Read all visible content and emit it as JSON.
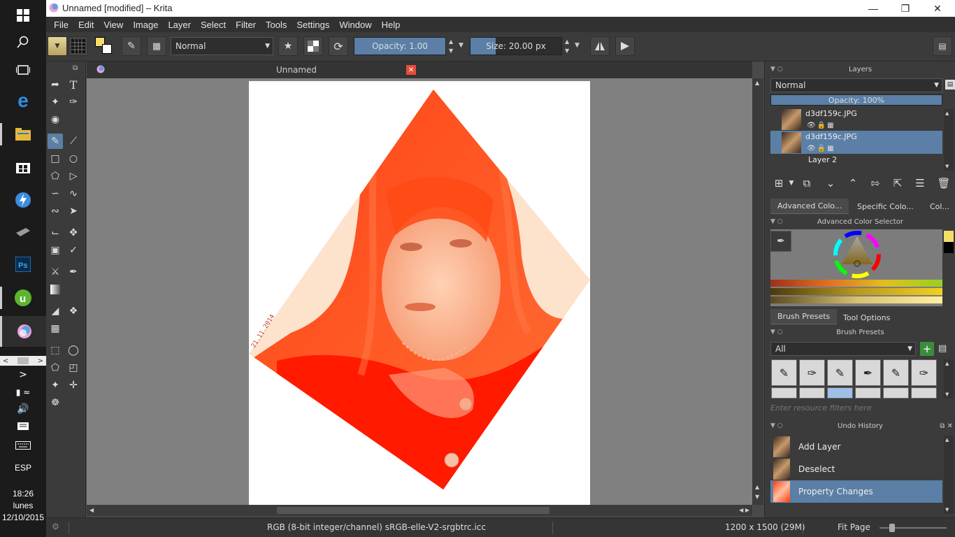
{
  "window": {
    "title": "Unnamed [modified] – Krita",
    "minimize": "—",
    "maximize": "❐",
    "close": "✕"
  },
  "menu": [
    "File",
    "Edit",
    "View",
    "Image",
    "Layer",
    "Select",
    "Filter",
    "Tools",
    "Settings",
    "Window",
    "Help"
  ],
  "toolbar": {
    "blend_mode": "Normal",
    "opacity_label": "Opacity:  1.00",
    "opacity_value": 1.0,
    "size_label": "Size:  20.00 px",
    "size_value": 20.0
  },
  "document_tab": {
    "label": "Unnamed",
    "close_icon": "close-icon"
  },
  "canvas": {
    "image_stamp": "21.11.2014"
  },
  "status": {
    "color_profile": "RGB (8-bit integer/channel)  sRGB-elle-V2-srgbtrc.icc",
    "dimensions": "1200 x 1500 (29M)",
    "zoom": "Fit Page"
  },
  "layers_docker": {
    "title": "Layers",
    "blend_mode": "Normal",
    "opacity": "Opacity:  100%",
    "opacity_value": 100,
    "layers": [
      {
        "name": "d3df159c.JPG",
        "selected": false
      },
      {
        "name": "d3df159c.JPG",
        "selected": true
      },
      {
        "name": "Layer 2",
        "selected": false
      }
    ]
  },
  "color_tabs": [
    "Advanced Colo...",
    "Specific Colo...",
    "Col..."
  ],
  "color_selector": {
    "title": "Advanced Color Selector",
    "foreground": "#f5dd6b",
    "background": "#000000"
  },
  "brush_tabs": [
    "Brush Presets",
    "Tool Options"
  ],
  "brush_presets": {
    "title": "Brush Presets",
    "filter": "All",
    "search_placeholder": "Enter resource filters here"
  },
  "undo_history": {
    "title": "Undo History",
    "items": [
      {
        "label": "Add Layer",
        "selected": false
      },
      {
        "label": "Deselect",
        "selected": false
      },
      {
        "label": "Property Changes",
        "selected": true
      }
    ]
  },
  "taskbar": {
    "language": "ESP",
    "time": "18:26",
    "day": "lunes",
    "date": "12/10/2015"
  },
  "colors": {
    "accent": "#5b7fa6",
    "panel": "#3b3b3b",
    "canvas_bg": "#808080"
  }
}
